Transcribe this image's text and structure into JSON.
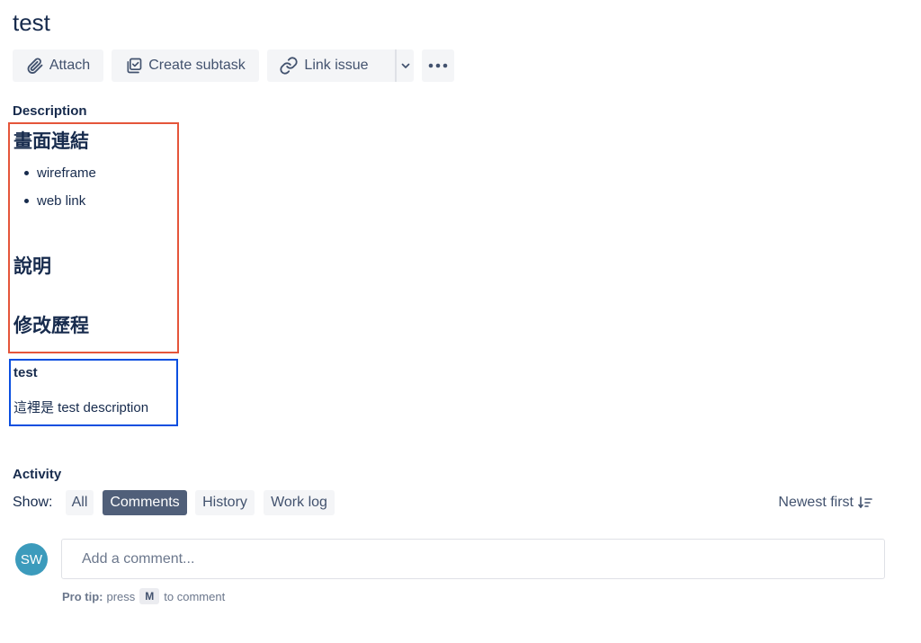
{
  "issue": {
    "title": "test"
  },
  "toolbar": {
    "attach_label": "Attach",
    "create_subtask_label": "Create subtask",
    "link_issue_label": "Link issue"
  },
  "description": {
    "label": "Description",
    "heading_1": "畫面連結",
    "bullets": [
      "wireframe",
      "web link"
    ],
    "heading_2": "說明",
    "heading_3": "修改歷程",
    "test_heading": "test",
    "test_text": "這裡是 test description"
  },
  "activity": {
    "label": "Activity",
    "show_label": "Show:",
    "filters": [
      "All",
      "Comments",
      "History",
      "Work log"
    ],
    "selected_filter": "Comments",
    "sort_label": "Newest first"
  },
  "comment": {
    "avatar_initials": "SW",
    "placeholder": "Add a comment...",
    "pro_tip_label": "Pro tip:",
    "pro_tip_press": "press",
    "pro_tip_key": "M",
    "pro_tip_suffix": "to comment"
  },
  "colors": {
    "annotation_red": "#e5553a",
    "annotation_blue": "#0b4fe0",
    "selected_filter_bg": "#505f79",
    "avatar_bg": "#3c9bbc"
  },
  "icons": [
    "paperclip-icon",
    "subtask-icon",
    "link-icon",
    "chevron-down-icon",
    "more-icon",
    "sort-icon"
  ]
}
